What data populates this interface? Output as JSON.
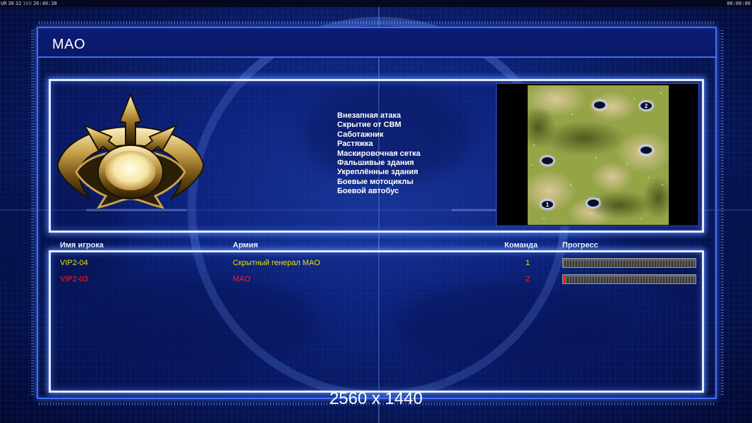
{
  "status_bar": {
    "seg1": "UR",
    "seg2": "30",
    "seg3": "32",
    "seg4": "160",
    "clock": "20:40:38",
    "timer": "00:00:00"
  },
  "title": "MAO",
  "rules": [
    "Внезапная атака",
    "Скрытие от СВМ",
    "Саботажник",
    "Растяжка",
    "Маскировочная сетка",
    "Фальшивые здания",
    "Укреплённые здания",
    "Боевые мотоциклы",
    "Боевой автобус"
  ],
  "map_starts": [
    {
      "label": ""
    },
    {
      "label": "2"
    },
    {
      "label": ""
    },
    {
      "label": ""
    },
    {
      "label": "1"
    },
    {
      "label": ""
    }
  ],
  "table": {
    "headers": {
      "player": "Имя игрока",
      "army": "Армия",
      "team": "Команда",
      "progress": "Прогресс"
    },
    "rows": [
      {
        "player": "VIP2-04",
        "army": "Скрытный генерал MAO",
        "team": "1",
        "color": "#e6e200",
        "progress": 0.0
      },
      {
        "player": "VIP2-03",
        "army": "MAO",
        "team": "2",
        "color": "#ff1e1e",
        "progress": 0.02
      }
    ]
  },
  "resolution": "2560 x 1440",
  "colors": {
    "frame": "#3f6dff",
    "panel_border": "#e4ecff",
    "team1": "#e6e200",
    "team2": "#ff1e1e"
  },
  "icons": {
    "faction_logo": "gla-emblem"
  }
}
